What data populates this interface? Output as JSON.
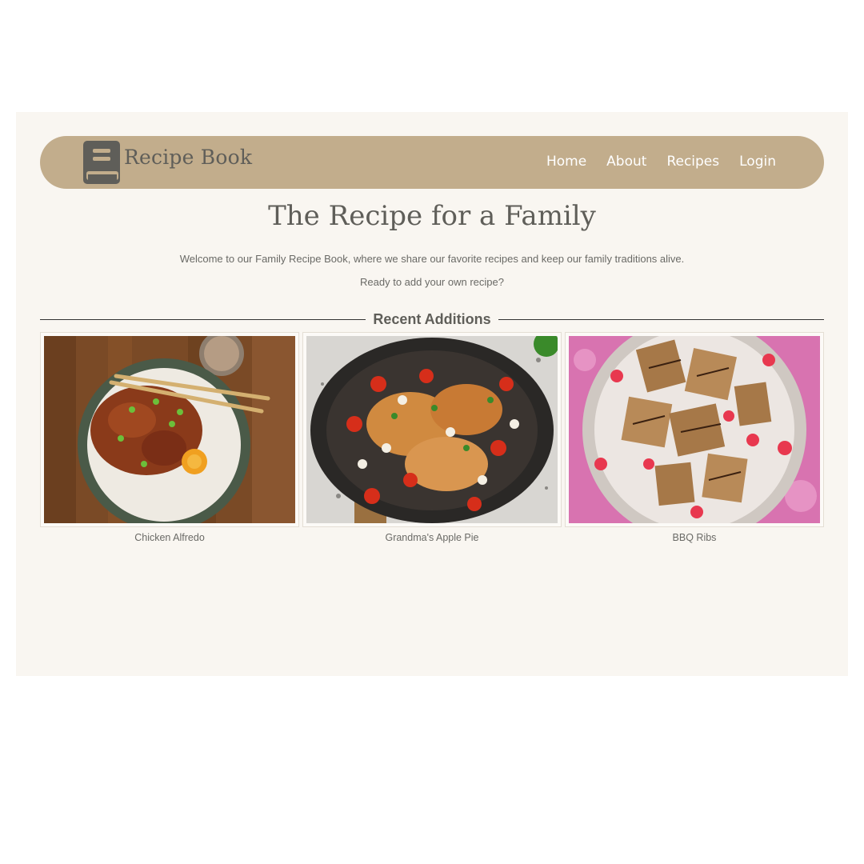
{
  "header": {
    "brand": "Recipe Book",
    "logo_icon": "book-icon",
    "nav": [
      {
        "label": "Home"
      },
      {
        "label": "About"
      },
      {
        "label": "Recipes"
      },
      {
        "label": "Login"
      }
    ]
  },
  "hero": {
    "title": "The Recipe for a Family",
    "welcome": "Welcome to our Family Recipe Book, where we share our favorite recipes and keep our family traditions alive.",
    "prompt": "Ready to add your own recipe?"
  },
  "recent": {
    "title": "Recent Additions",
    "cards": [
      {
        "caption": "Chicken Alfredo",
        "image": "rice-bowl-photo"
      },
      {
        "caption": "Grandma's Apple Pie",
        "image": "skillet-photo"
      },
      {
        "caption": "BBQ Ribs",
        "image": "dessert-bars-photo"
      }
    ]
  },
  "colors": {
    "navbar": "#c2ad8c",
    "page_background": "#f9f6f1",
    "text": "#5f5e59"
  }
}
